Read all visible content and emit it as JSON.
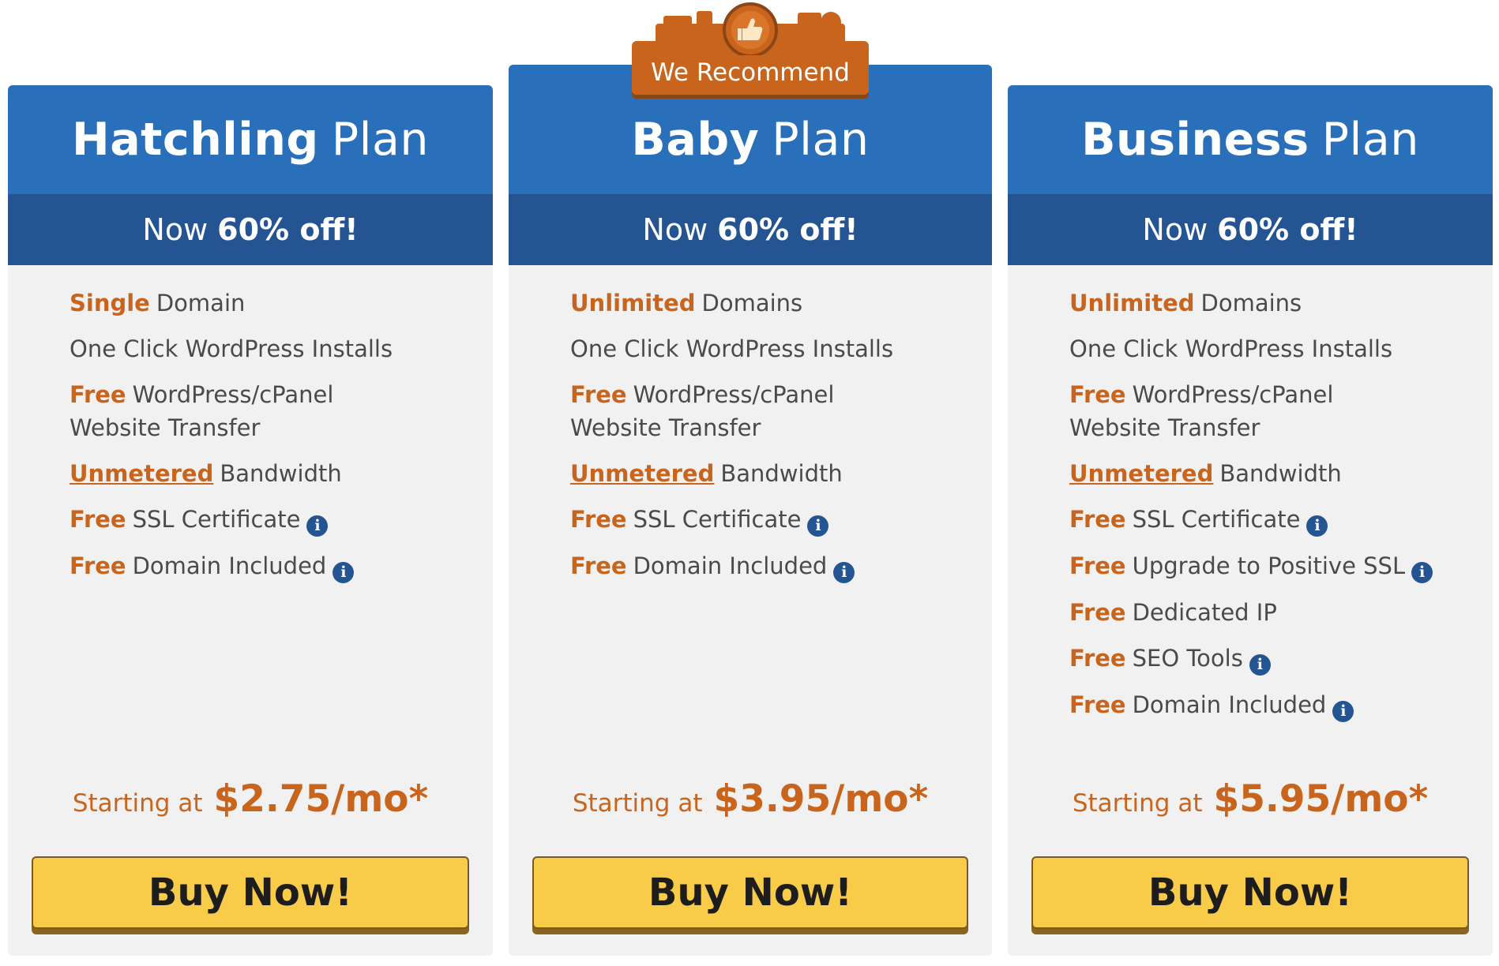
{
  "badge": {
    "label": "We Recommend",
    "icon": "thumbs-up-icon"
  },
  "plans": [
    {
      "name": "Hatchling",
      "suffix": "Plan",
      "discount_prefix": "Now",
      "discount_value": "60% off!",
      "features": [
        {
          "hl": "Single",
          "text": "Domain"
        },
        {
          "hl": "",
          "text": "One Click WordPress Installs"
        },
        {
          "hl": "Free",
          "text": "WordPress/cPanel Website Transfer"
        },
        {
          "hl": "Unmetered",
          "text": "Bandwidth"
        },
        {
          "hl": "Free",
          "text": "SSL Certificate"
        },
        {
          "hl": "Free",
          "text": "Domain Included"
        }
      ],
      "price_prefix": "Starting at",
      "price": "$2.75/mo*",
      "button": "Buy Now!"
    },
    {
      "name": "Baby",
      "suffix": "Plan",
      "discount_prefix": "Now",
      "discount_value": "60% off!",
      "features": [
        {
          "hl": "Unlimited",
          "text": "Domains"
        },
        {
          "hl": "",
          "text": "One Click WordPress Installs"
        },
        {
          "hl": "Free",
          "text": "WordPress/cPanel Website Transfer"
        },
        {
          "hl": "Unmetered",
          "text": "Bandwidth"
        },
        {
          "hl": "Free",
          "text": "SSL Certificate"
        },
        {
          "hl": "Free",
          "text": "Domain Included"
        }
      ],
      "price_prefix": "Starting at",
      "price": "$3.95/mo*",
      "button": "Buy Now!"
    },
    {
      "name": "Business",
      "suffix": "Plan",
      "discount_prefix": "Now",
      "discount_value": "60% off!",
      "features": [
        {
          "hl": "Unlimited",
          "text": "Domains"
        },
        {
          "hl": "",
          "text": "One Click WordPress Installs"
        },
        {
          "hl": "Free",
          "text": "WordPress/cPanel Website Transfer"
        },
        {
          "hl": "Unmetered",
          "text": "Bandwidth"
        },
        {
          "hl": "Free",
          "text": "SSL Certificate"
        },
        {
          "hl": "Free",
          "text": "Upgrade to Positive SSL"
        },
        {
          "hl": "Free",
          "text": "Dedicated IP"
        },
        {
          "hl": "Free",
          "text": "SEO Tools"
        },
        {
          "hl": "Free",
          "text": "Domain Included"
        }
      ],
      "price_prefix": "Starting at",
      "price": "$5.95/mo*",
      "button": "Buy Now!"
    }
  ],
  "colors": {
    "header_blue": "#2a6fba",
    "discount_blue": "#245592",
    "accent_orange": "#c9641d",
    "button_yellow": "#f8cb49",
    "card_bg": "#f1f1f1"
  },
  "info_icon": "i"
}
